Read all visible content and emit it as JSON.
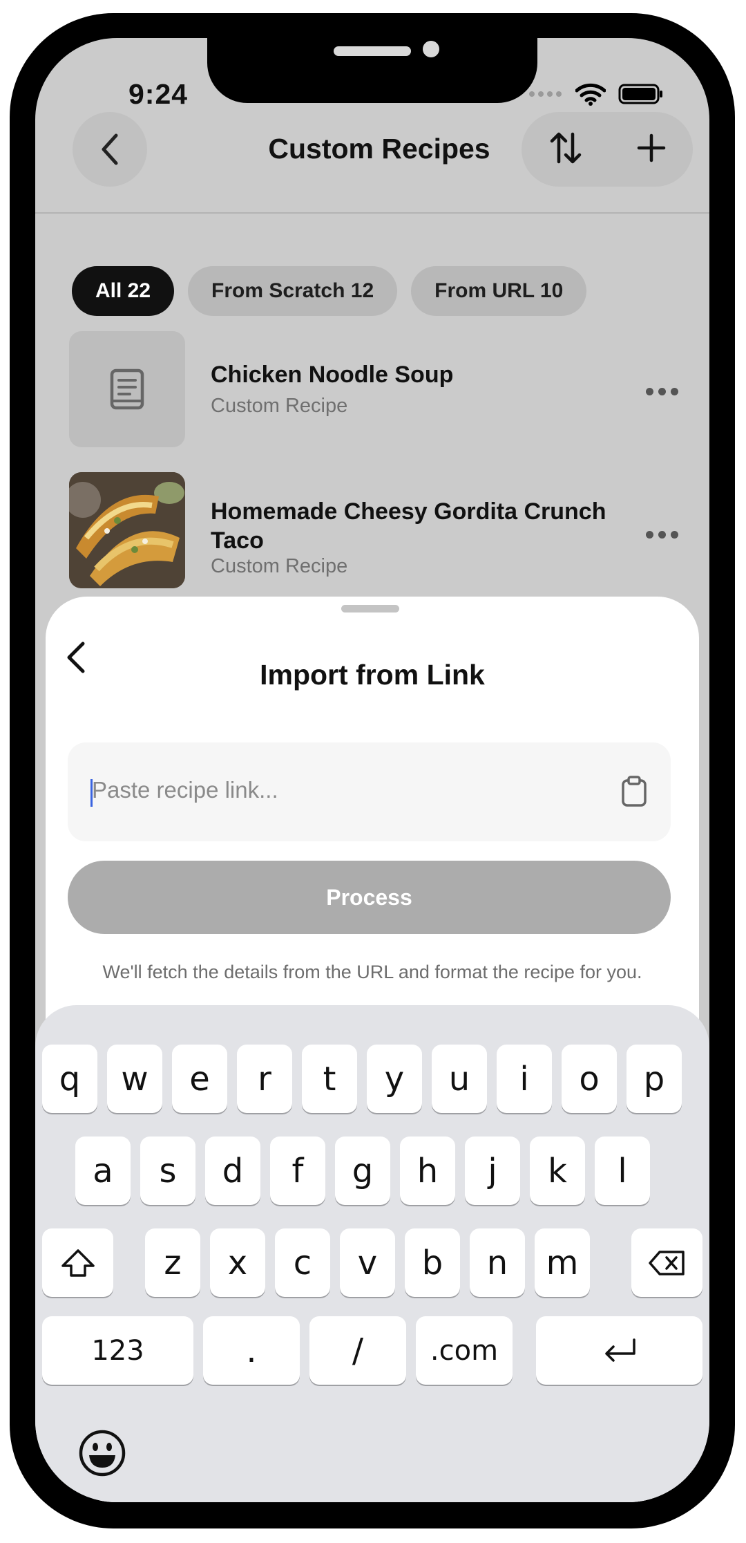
{
  "status": {
    "time": "9:24"
  },
  "nav": {
    "title": "Custom Recipes"
  },
  "filters": [
    {
      "label": "All 22",
      "active": true
    },
    {
      "label": "From Scratch 12",
      "active": false
    },
    {
      "label": "From URL 10",
      "active": false
    }
  ],
  "recipes": [
    {
      "title": "Chicken Noodle Soup",
      "subtitle": "Custom Recipe"
    },
    {
      "title": "Homemade Cheesy Gordita Crunch Taco",
      "subtitle": "Custom Recipe"
    }
  ],
  "sheet": {
    "title": "Import from Link",
    "input_placeholder": "Paste recipe link...",
    "process_label": "Process",
    "helper_text": "We'll fetch the details from the URL and format the recipe for you."
  },
  "keyboard": {
    "row1": [
      "q",
      "w",
      "e",
      "r",
      "t",
      "y",
      "u",
      "i",
      "o",
      "p"
    ],
    "row2": [
      "a",
      "s",
      "d",
      "f",
      "g",
      "h",
      "j",
      "k",
      "l"
    ],
    "row3": [
      "z",
      "x",
      "c",
      "v",
      "b",
      "n",
      "m"
    ],
    "row4": [
      "123",
      ".",
      "/",
      ".com"
    ]
  },
  "colors": {
    "accent_caret": "#3a64e0",
    "active_chip": "#111111",
    "process_disabled": "#acacac"
  }
}
